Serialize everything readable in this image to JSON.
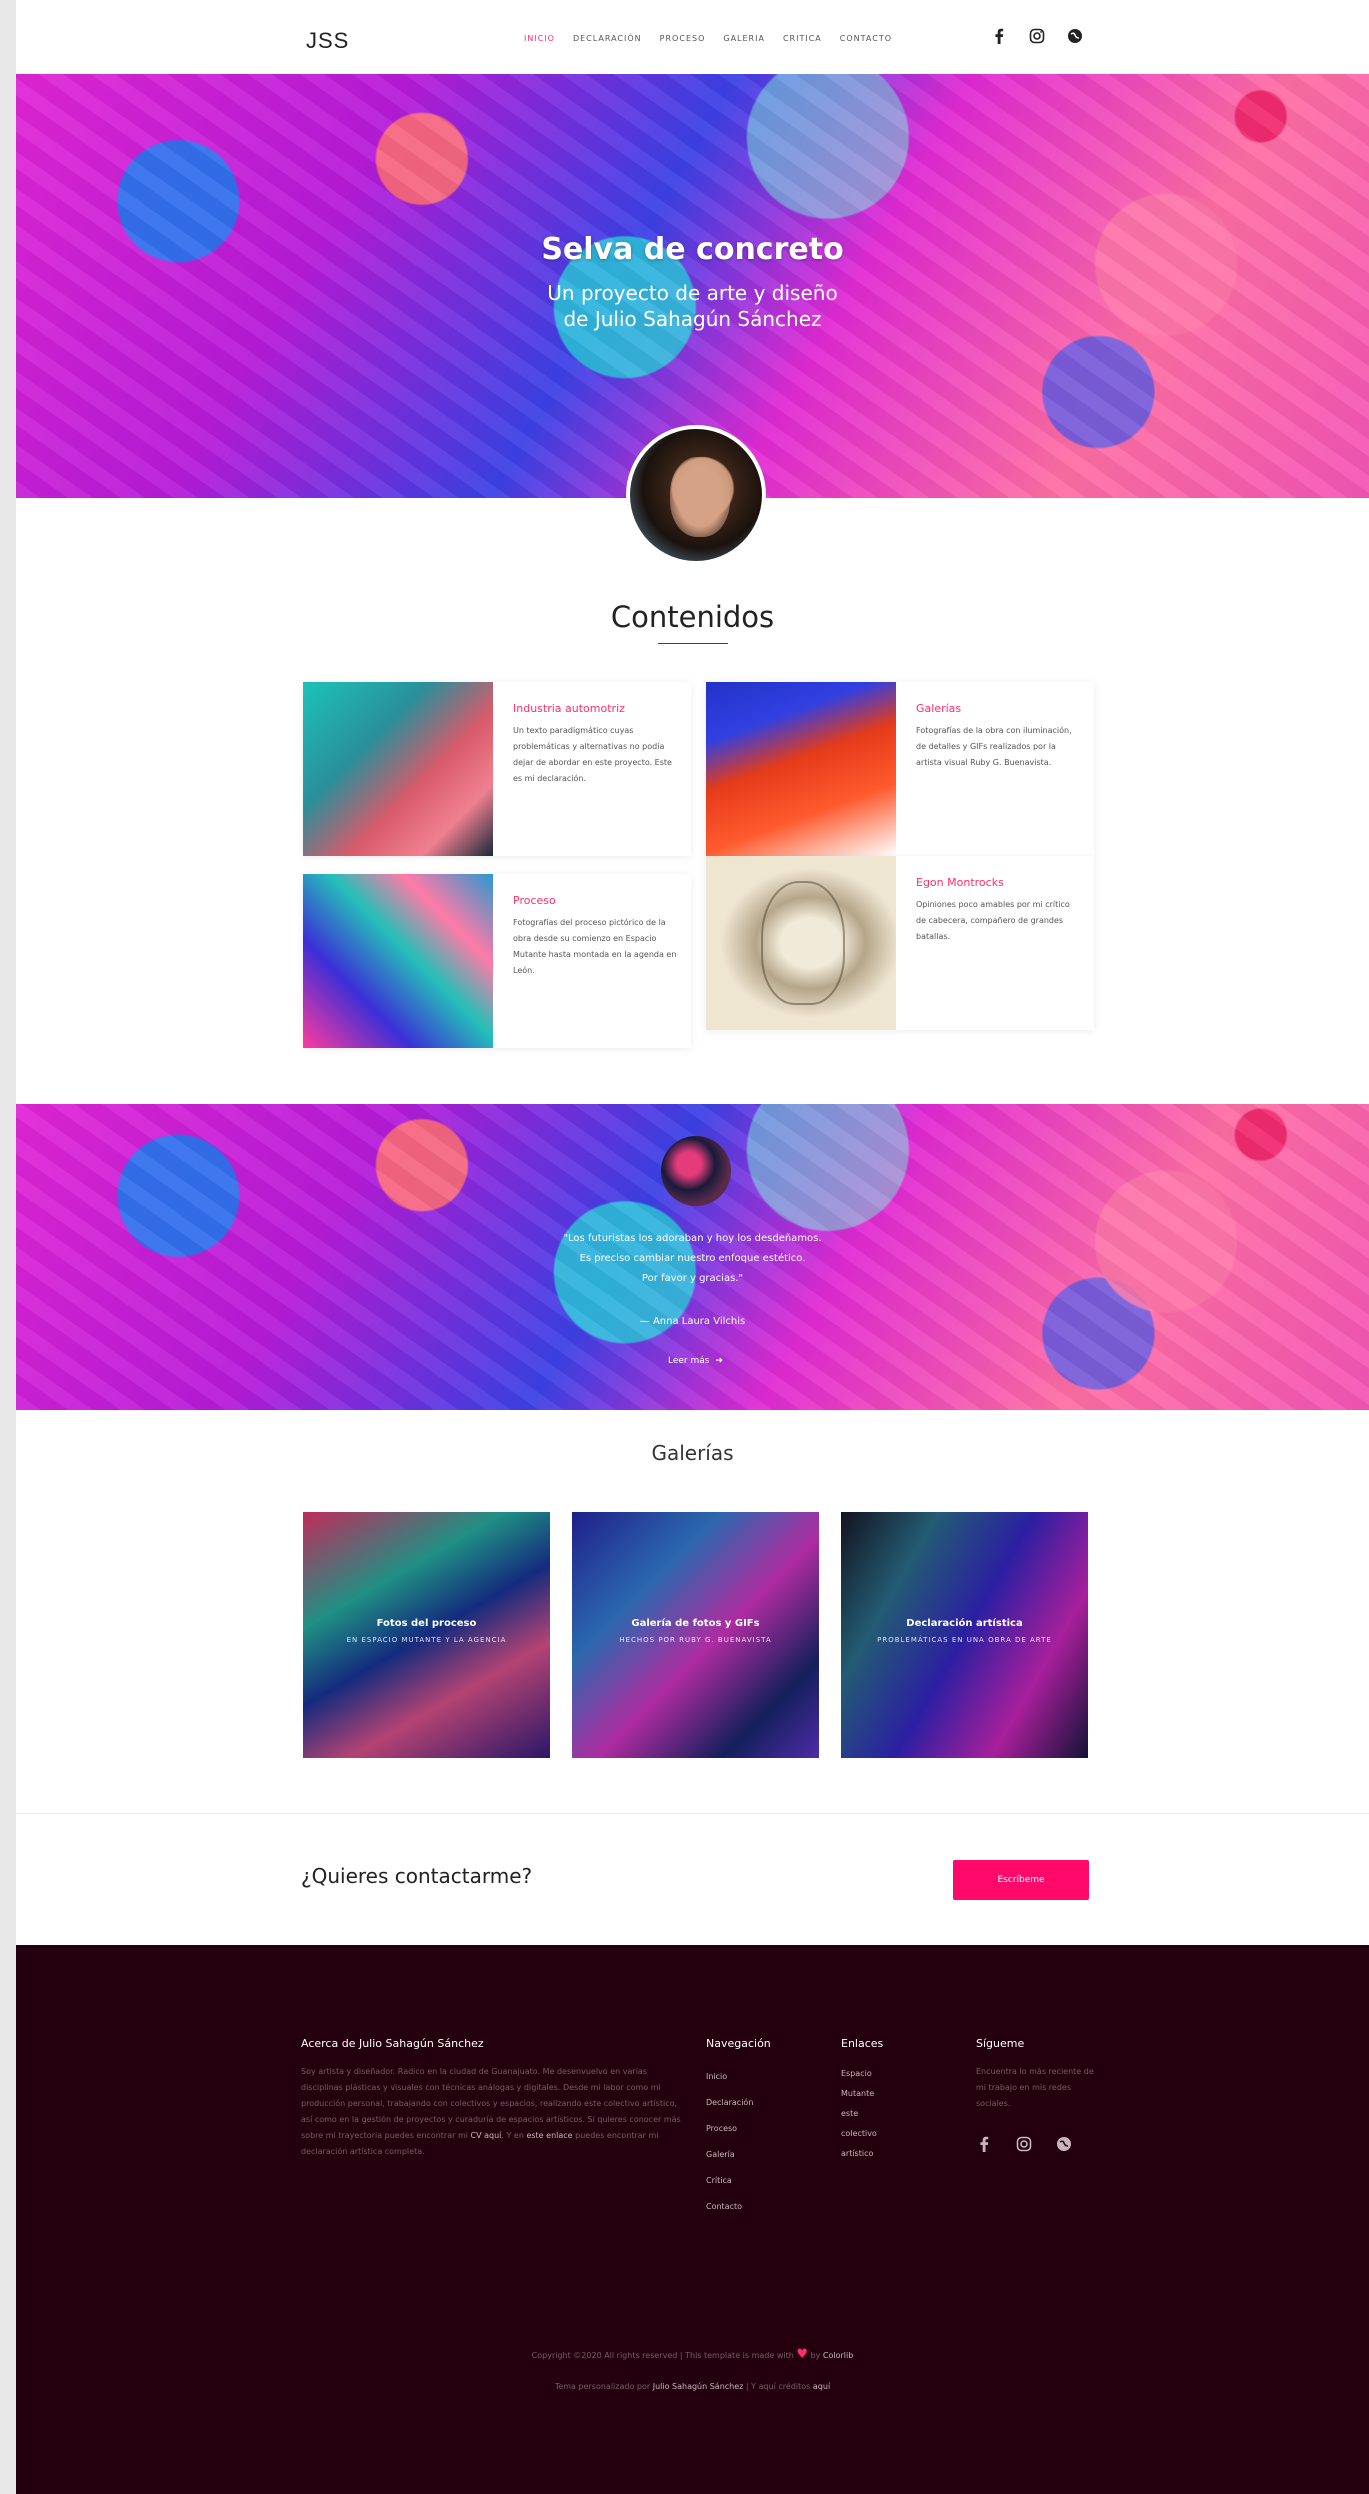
{
  "nav": {
    "logo": "JSS",
    "items": [
      "INICIO",
      "DECLARACIÓN",
      "PROCESO",
      "GALERIA",
      "CRITICA",
      "CONTACTO"
    ],
    "active_index": 0,
    "icons": [
      "facebook-icon",
      "instagram-icon",
      "globe-icon"
    ]
  },
  "hero": {
    "title": "Selva de concreto",
    "subtitle_line1": "Un proyecto de arte y diseño",
    "subtitle_line2": "de Julio Sahagún Sánchez"
  },
  "contenidos": {
    "title": "Contenidos",
    "cards": [
      {
        "title": "Industria automotriz",
        "desc": "Un texto paradigmático cuyas problemáticas y alternativas no podía dejar de abordar en este proyecto. Este es mi declaración."
      },
      {
        "title": "Galerías",
        "desc": "Fotografías de la obra con iluminación, de detalles y GIFs realizados por la artista visual Ruby G. Buenavista."
      },
      {
        "title": "Proceso",
        "desc": "Fotografías del proceso pictórico de la obra desde su comienzo en Espacio Mutante hasta montada en la agenda en León."
      },
      {
        "title": "Egon Montrocks",
        "desc": "Opiniones poco amables por mi crítico de cabecera, compañero de grandes batallas."
      }
    ]
  },
  "quote": {
    "line1": "\"Los futuristas los adoraban y hoy los desdeñamos.",
    "line2": "Es preciso cambiar nuestro enfoque estético.",
    "line3": "Por favor y gracias.\"",
    "author": "— Anna Laura Vilchis",
    "more": "Leer más"
  },
  "galerias": {
    "title": "Galerías",
    "items": [
      {
        "title": "Fotos del proceso",
        "sub": "EN ESPACIO MUTANTE Y LA AGENCIA"
      },
      {
        "title": "Galería de fotos y GIFs",
        "sub": "HECHOS POR RUBY G. BUENAVISTA"
      },
      {
        "title": "Declaración artística",
        "sub": "PROBLEMÁTICAS EN UNA OBRA DE ARTE"
      }
    ]
  },
  "contact": {
    "question": "¿Quieres contactarme?",
    "button": "Escríbeme"
  },
  "footer": {
    "about_title": "Acerca de Julio Sahagún Sánchez",
    "about_text": "Soy artista y diseñador. Radico en la ciudad de Guanajuato. Me desenvuelvo en varias disciplinas plásticas y visuales con técnicas análogas y digitales. Desde mi labor como mi producción personal, trabajando con colectivos y espacios, realizando este colectivo artístico, así como en la gestión de proyectos y curaduría de espacios artísticos. Si quieres conocer más sobre mi trayectoria puedes encontrar mi",
    "about_cv": "CV aquí",
    "about_mid": ". Y en",
    "about_link": "este enlace",
    "about_end": "puedes encontrar mi declaración artística completa.",
    "nav_title": "Navegación",
    "nav_links": [
      "Inicio",
      "Declaración",
      "Proceso",
      "Galería",
      "Crítica",
      "Contacto"
    ],
    "links_title": "Enlaces",
    "links": [
      "Espacio",
      "Mutante",
      "",
      "este",
      "colectivo",
      "artístico"
    ],
    "follow_title": "Sígueme",
    "follow_text": "Encuentra lo más reciente de mi trabajo en mis redes sociales.",
    "copyright_pre": "Copyright ©2020 All rights reserved | This template is made with",
    "copyright_by": "by",
    "copyright_brand": "Colorlib",
    "theme_pre": "Tema personalizado por",
    "theme_name": "Julio Sahagún Sánchez",
    "theme_mid": "| Y aquí créditos",
    "theme_link": "aquí"
  },
  "colors": {
    "accent": "#ff2d6e",
    "button": "#ff0a6a",
    "footer_bg": "#24000f"
  }
}
